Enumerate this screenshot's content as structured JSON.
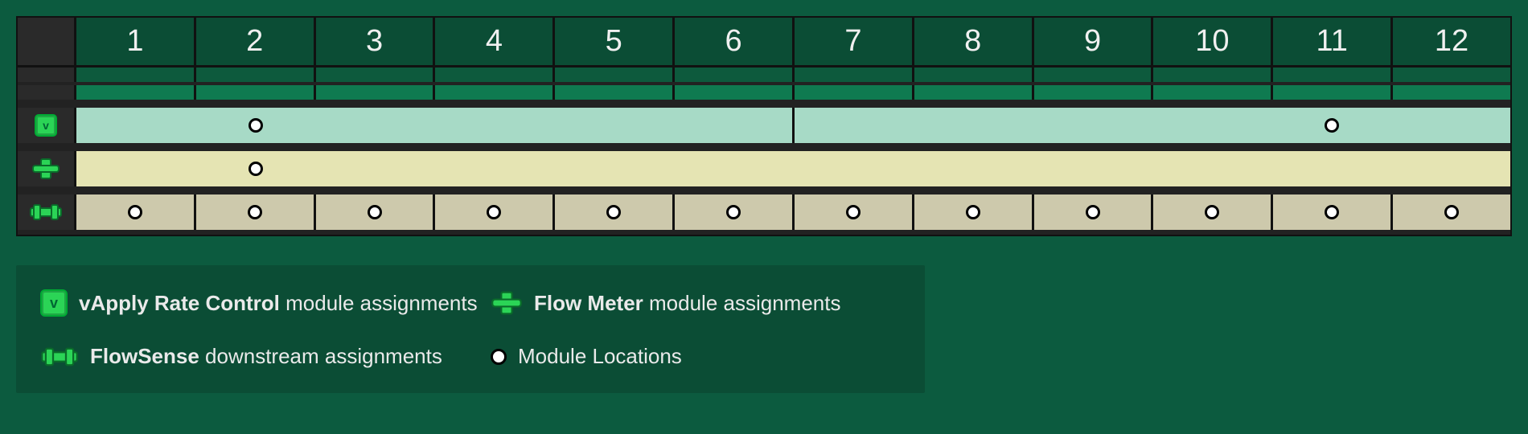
{
  "columns": [
    "1",
    "2",
    "3",
    "4",
    "5",
    "6",
    "7",
    "8",
    "9",
    "10",
    "11",
    "12"
  ],
  "rows": {
    "vapply": {
      "segments": [
        {
          "span": 6,
          "dots": [
            {
              "col": 2
            }
          ]
        },
        {
          "span": 6,
          "dots": [
            {
              "col": 11
            }
          ]
        }
      ]
    },
    "flowmeter": {
      "segments": [
        {
          "span": 12,
          "dots": [
            {
              "col": 2
            }
          ]
        }
      ]
    },
    "flowsense": {
      "segments": [
        {
          "span": 1,
          "dots": [
            {
              "col": 1
            }
          ]
        },
        {
          "span": 1,
          "dots": [
            {
              "col": 2
            }
          ]
        },
        {
          "span": 1,
          "dots": [
            {
              "col": 3
            }
          ]
        },
        {
          "span": 1,
          "dots": [
            {
              "col": 4
            }
          ]
        },
        {
          "span": 1,
          "dots": [
            {
              "col": 5
            }
          ]
        },
        {
          "span": 1,
          "dots": [
            {
              "col": 6
            }
          ]
        },
        {
          "span": 1,
          "dots": [
            {
              "col": 7
            }
          ]
        },
        {
          "span": 1,
          "dots": [
            {
              "col": 8
            }
          ]
        },
        {
          "span": 1,
          "dots": [
            {
              "col": 9
            }
          ]
        },
        {
          "span": 1,
          "dots": [
            {
              "col": 10
            }
          ]
        },
        {
          "span": 1,
          "dots": [
            {
              "col": 11
            }
          ]
        },
        {
          "span": 1,
          "dots": [
            {
              "col": 12
            }
          ]
        }
      ]
    }
  },
  "legend": {
    "vapply_bold": "vApply Rate Control",
    "vapply_rest": " module assignments",
    "flowmeter_bold": "Flow Meter",
    "flowmeter_rest": " module assignments",
    "flowsense_bold": "FlowSense",
    "flowsense_rest": " downstream assignments",
    "module_loc": "Module Locations"
  },
  "icon_labels": {
    "vapply_glyph": "v"
  }
}
